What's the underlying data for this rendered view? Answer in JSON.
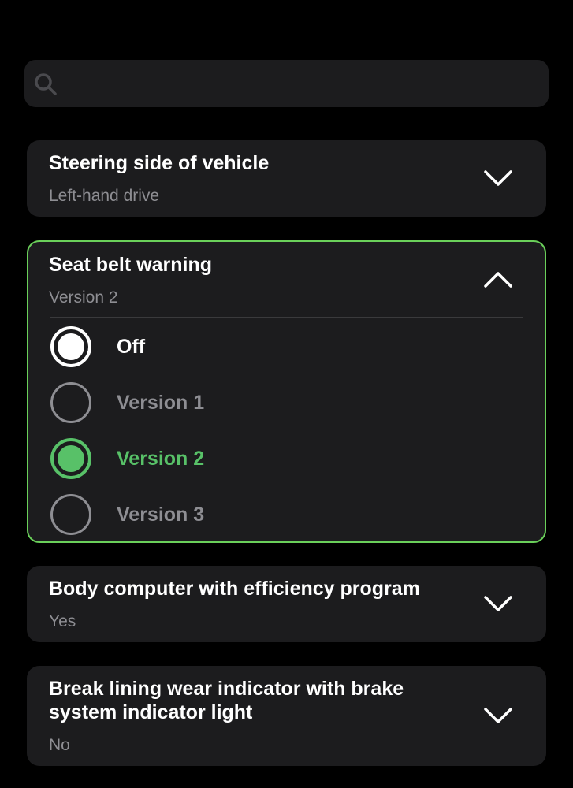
{
  "search": {
    "placeholder": "",
    "icon": "search-icon"
  },
  "settings": [
    {
      "title": "Steering side of vehicle",
      "value": "Left-hand drive",
      "expanded": false
    },
    {
      "title": "Seat belt warning",
      "value": "Version 2",
      "expanded": true,
      "options": [
        {
          "label": "Off",
          "state": "highlighted"
        },
        {
          "label": "Version 1",
          "state": "unselected"
        },
        {
          "label": "Version 2",
          "state": "selected"
        },
        {
          "label": "Version 3",
          "state": "unselected"
        }
      ]
    },
    {
      "title": "Body computer with efficiency program",
      "value": "Yes",
      "expanded": false
    },
    {
      "title": "Break lining wear indicator with brake system indicator light",
      "value": "No",
      "expanded": false
    }
  ],
  "colors": {
    "accent": "#58c168",
    "card": "#1c1c1e",
    "muted": "#8e8e93",
    "background": "#000000"
  }
}
